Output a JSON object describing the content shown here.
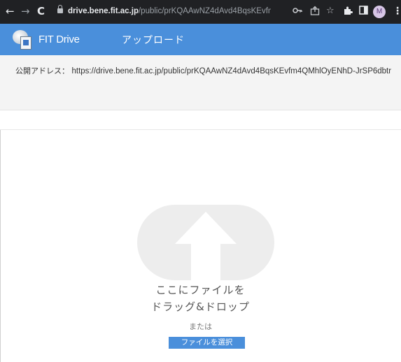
{
  "browser": {
    "url_host": "drive.bene.fit.ac.jp",
    "url_path": "/public/prKQAAwNZ4dAvd4BqsKEvfm4QMhlOy...",
    "profile_initial": "M",
    "nav_icons": [
      "back-arrow-icon",
      "forward-arrow-icon",
      "reload-icon"
    ],
    "toolbar_icons": [
      "key-icon",
      "share-icon",
      "star-icon",
      "extensions-icon",
      "sidepanel-icon",
      "profile-avatar-icon",
      "kebab-menu-icon"
    ]
  },
  "app": {
    "brand": "FIT Drive",
    "page_title": "アップロード",
    "header_color": "#4a8fdb"
  },
  "address": {
    "label": "公開アドレス：",
    "value": "https://drive.bene.fit.ac.jp/public/prKQAAwNZ4dAvd4BqsKEvfm4QMhlOyENhD-JrSP6dbtr"
  },
  "dropzone": {
    "icon": "upload-cloud-arrow-icon",
    "line1": "ここにファイルを",
    "line2": "ドラッグ&ドロップ",
    "or_text": "または",
    "button_label": "ファイルを選択"
  }
}
